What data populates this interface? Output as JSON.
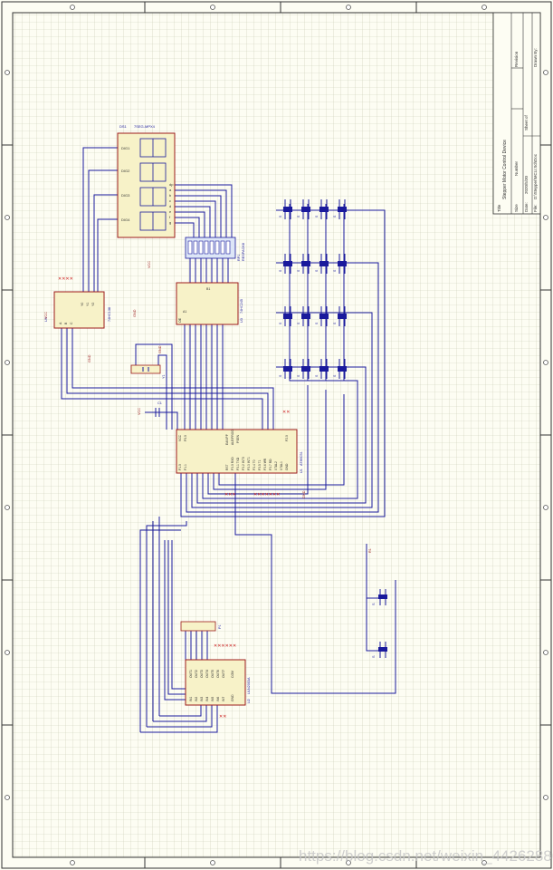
{
  "title_block": {
    "title_label": "Title",
    "title_value": "Stepper Motor Control Device",
    "size_label": "Size",
    "number_label": "Number",
    "revision_label": "Revision",
    "date_label": "Date:",
    "date_value": "2020/5/30",
    "file_label": "File:",
    "file_value": "D:\\Stepper\\MCU.SchDoc",
    "sheet_label": "Sheet of",
    "drawn_label": "Drawn By:",
    "grid_note": "Sheet1"
  },
  "components": {
    "display": {
      "ref": "DS1",
      "name": "7SEG-MPX4",
      "digits": [
        "DIG1",
        "DIG2",
        "DIG3",
        "DIG4"
      ],
      "segs": [
        "dp",
        "a",
        "b",
        "c",
        "d",
        "e",
        "f",
        "g"
      ]
    },
    "rpack": {
      "ref": "RP1",
      "name": "RESPACK8"
    },
    "latch": {
      "ref": "U3",
      "name": "74HC245",
      "left_pins": [
        "OE",
        "A1",
        "A2",
        "A3",
        "A4",
        "A5",
        "A6",
        "A7",
        "A8"
      ],
      "right_pins": [
        "VCC",
        "B1",
        "B2",
        "B3",
        "B4",
        "B5",
        "B6",
        "B7",
        "B8",
        "GND"
      ]
    },
    "decoder": {
      "ref": "U4",
      "name": "74HC138",
      "left_pins": [
        "A",
        "B",
        "C",
        "E1",
        "E2",
        "E3"
      ],
      "right_pins": [
        "Y0",
        "Y1",
        "Y2",
        "Y3",
        "Y4",
        "Y5",
        "Y6",
        "Y7"
      ]
    },
    "crystal": {
      "ref": "Y1",
      "name": "12MHz"
    },
    "mcu": {
      "ref": "U1",
      "name": "AT89C51",
      "top_pins": [
        "VCC",
        "P0.0",
        "P0.1",
        "P0.2",
        "P0.3",
        "P0.4",
        "P0.5",
        "P0.6",
        "P0.7",
        "EA/VPP",
        "ALE/PROG",
        "PSEN",
        "P2.7",
        "P2.6",
        "P2.5",
        "P2.4",
        "P2.3",
        "P2.2",
        "P2.1",
        "P2.0"
      ],
      "bottom_pins": [
        "P1.0",
        "P1.1",
        "P1.2",
        "P1.3",
        "P1.4",
        "P1.5",
        "P1.6",
        "P1.7",
        "RST",
        "P3.0 RXD",
        "P3.1 TXD",
        "P3.2 INT0",
        "P3.3 INT1",
        "P3.4 T0",
        "P3.5 T1",
        "P3.6 WR",
        "P3.7 RD",
        "XTAL2",
        "XTAL1",
        "GND"
      ]
    },
    "driver": {
      "ref": "U2",
      "name": "ULN2003A",
      "in_pins": [
        "IN1",
        "IN2",
        "IN3",
        "IN4",
        "IN5",
        "IN6",
        "IN7"
      ],
      "out_pins": [
        "OUT1",
        "OUT2",
        "OUT3",
        "OUT4",
        "OUT5",
        "OUT6",
        "OUT7"
      ],
      "com": "COM",
      "gnd": "GND"
    },
    "connector": {
      "ref": "P1",
      "name": "Header 5"
    },
    "keys": {
      "label": "S",
      "count": 16
    },
    "extra_keys": {
      "label": "S",
      "count": 2
    },
    "net_labels": {
      "vcc": "VCC",
      "gnd": "GND",
      "cap": "C1",
      "res": "R1"
    }
  },
  "watermark": "https://blog.csdn.net/weixin_44262886"
}
